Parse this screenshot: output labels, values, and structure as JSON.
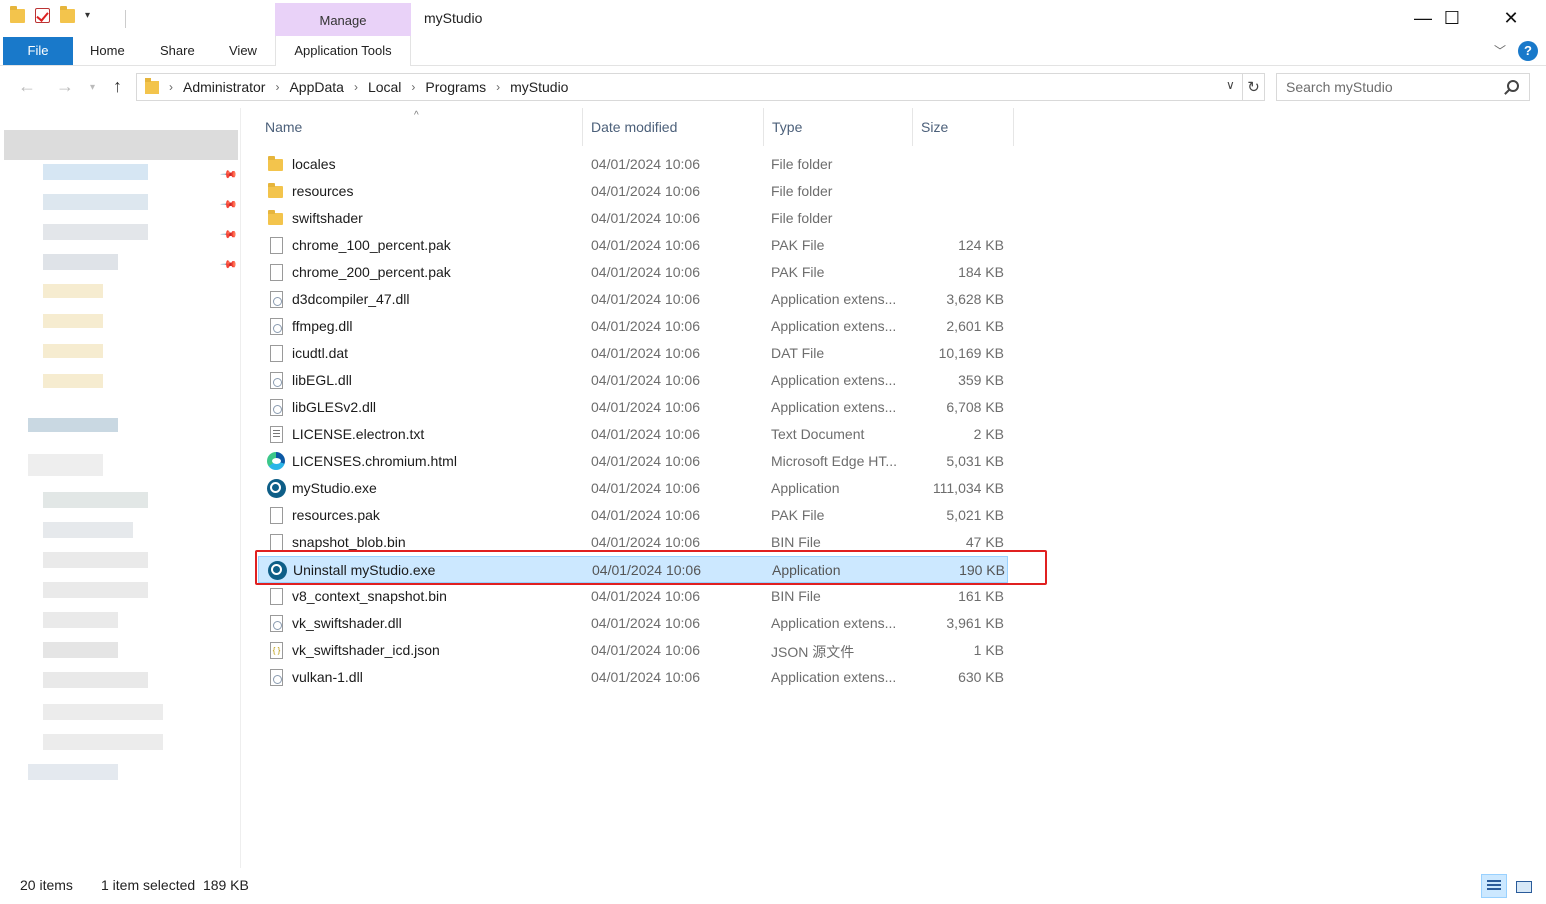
{
  "window": {
    "title": "myStudio",
    "manage_tab": "Manage",
    "minimize": "—",
    "maximize": "☐",
    "close": "✕"
  },
  "ribbon": {
    "tabs": [
      {
        "label": "File"
      },
      {
        "label": "Home"
      },
      {
        "label": "Share"
      },
      {
        "label": "View"
      },
      {
        "label": "Application Tools"
      }
    ],
    "help": "?"
  },
  "address": {
    "breadcrumbs": [
      "Administrator",
      "AppData",
      "Local",
      "Programs",
      "myStudio"
    ]
  },
  "search": {
    "placeholder": "Search myStudio"
  },
  "columns": {
    "name": "Name",
    "date": "Date modified",
    "type": "Type",
    "size": "Size"
  },
  "files": [
    {
      "name": "locales",
      "date": "04/01/2024 10:06",
      "type": "File folder",
      "size": "",
      "icon": "folder-icon"
    },
    {
      "name": "resources",
      "date": "04/01/2024 10:06",
      "type": "File folder",
      "size": "",
      "icon": "folder-icon"
    },
    {
      "name": "swiftshader",
      "date": "04/01/2024 10:06",
      "type": "File folder",
      "size": "",
      "icon": "folder-icon"
    },
    {
      "name": "chrome_100_percent.pak",
      "date": "04/01/2024 10:06",
      "type": "PAK File",
      "size": "124 KB",
      "icon": "file-icon"
    },
    {
      "name": "chrome_200_percent.pak",
      "date": "04/01/2024 10:06",
      "type": "PAK File",
      "size": "184 KB",
      "icon": "file-icon"
    },
    {
      "name": "d3dcompiler_47.dll",
      "date": "04/01/2024 10:06",
      "type": "Application extens...",
      "size": "3,628 KB",
      "icon": "dll-icon"
    },
    {
      "name": "ffmpeg.dll",
      "date": "04/01/2024 10:06",
      "type": "Application extens...",
      "size": "2,601 KB",
      "icon": "dll-icon"
    },
    {
      "name": "icudtl.dat",
      "date": "04/01/2024 10:06",
      "type": "DAT File",
      "size": "10,169 KB",
      "icon": "file-icon"
    },
    {
      "name": "libEGL.dll",
      "date": "04/01/2024 10:06",
      "type": "Application extens...",
      "size": "359 KB",
      "icon": "dll-icon"
    },
    {
      "name": "libGLESv2.dll",
      "date": "04/01/2024 10:06",
      "type": "Application extens...",
      "size": "6,708 KB",
      "icon": "dll-icon"
    },
    {
      "name": "LICENSE.electron.txt",
      "date": "04/01/2024 10:06",
      "type": "Text Document",
      "size": "2 KB",
      "icon": "text-file-icon"
    },
    {
      "name": "LICENSES.chromium.html",
      "date": "04/01/2024 10:06",
      "type": "Microsoft Edge HT...",
      "size": "5,031 KB",
      "icon": "edge-icon"
    },
    {
      "name": "myStudio.exe",
      "date": "04/01/2024 10:06",
      "type": "Application",
      "size": "111,034 KB",
      "icon": "app-icon"
    },
    {
      "name": "resources.pak",
      "date": "04/01/2024 10:06",
      "type": "PAK File",
      "size": "5,021 KB",
      "icon": "file-icon"
    },
    {
      "name": "snapshot_blob.bin",
      "date": "04/01/2024 10:06",
      "type": "BIN File",
      "size": "47 KB",
      "icon": "file-icon"
    },
    {
      "name": "Uninstall myStudio.exe",
      "date": "04/01/2024 10:06",
      "type": "Application",
      "size": "190 KB",
      "icon": "app-icon",
      "selected": true
    },
    {
      "name": "v8_context_snapshot.bin",
      "date": "04/01/2024 10:06",
      "type": "BIN File",
      "size": "161 KB",
      "icon": "file-icon"
    },
    {
      "name": "vk_swiftshader.dll",
      "date": "04/01/2024 10:06",
      "type": "Application extens...",
      "size": "3,961 KB",
      "icon": "dll-icon"
    },
    {
      "name": "vk_swiftshader_icd.json",
      "date": "04/01/2024 10:06",
      "type": "JSON 源文件",
      "size": "1 KB",
      "icon": "json-icon"
    },
    {
      "name": "vulkan-1.dll",
      "date": "04/01/2024 10:06",
      "type": "Application extens...",
      "size": "630 KB",
      "icon": "dll-icon"
    }
  ],
  "status": {
    "item_count": "20 items",
    "selection": "1 item selected  189 KB"
  },
  "colors": {
    "accent": "#1979ca",
    "selection": "#cce8ff",
    "highlight_box": "#e02020",
    "manage_tab": "#e9d2f8"
  }
}
